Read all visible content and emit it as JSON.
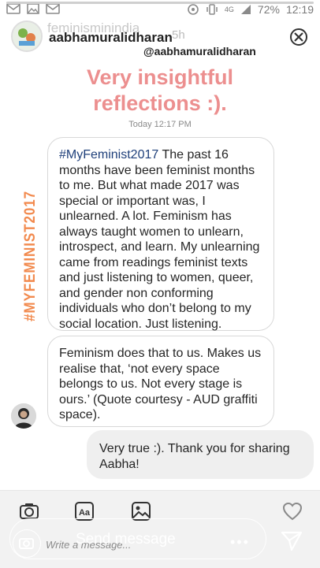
{
  "status_bar": {
    "network": "4G",
    "battery": "72%",
    "time": "12:19"
  },
  "story": {
    "progress_percent": 100,
    "faded_title": "feminisminindia",
    "username": "aabhamuralidharan",
    "time_ago": "5h",
    "mention": "@aabhamuralidharan"
  },
  "content": {
    "heading_line1": "Very insightful",
    "heading_line2": "reflections :).",
    "timestamp": "Today 12:17 PM",
    "vertical_tag": "#MYFEMINIST2017",
    "message1_hashtag": "#MyFeminist2017",
    "message1_text": " The past 16 months have been feminist months to me. But what made 2017 was special or important was, I unlearned. A lot. Feminism has always taught women to unlearn, introspect, and learn. My unlearning came from readings feminist texts and just listening to women, queer, and gender non conforming individuals who don’t belong to my social location. Just listening.",
    "message2_text": "Feminism does that to us. Makes us realise that, ‘not every space belongs to us. Not every stage is ours.’ (Quote courtesy - AUD graffiti space).",
    "reply_text": "Very true :). Thank you for sharing Aabha!"
  },
  "bottom": {
    "placeholder": "Write a message...",
    "send_label": "Send message",
    "more_label": "•••",
    "font_icon_label": "Aa"
  },
  "colors": {
    "heading": "#ec8f8f",
    "vertical_tag": "#f28a4e",
    "hashtag": "#1e3f7a"
  }
}
